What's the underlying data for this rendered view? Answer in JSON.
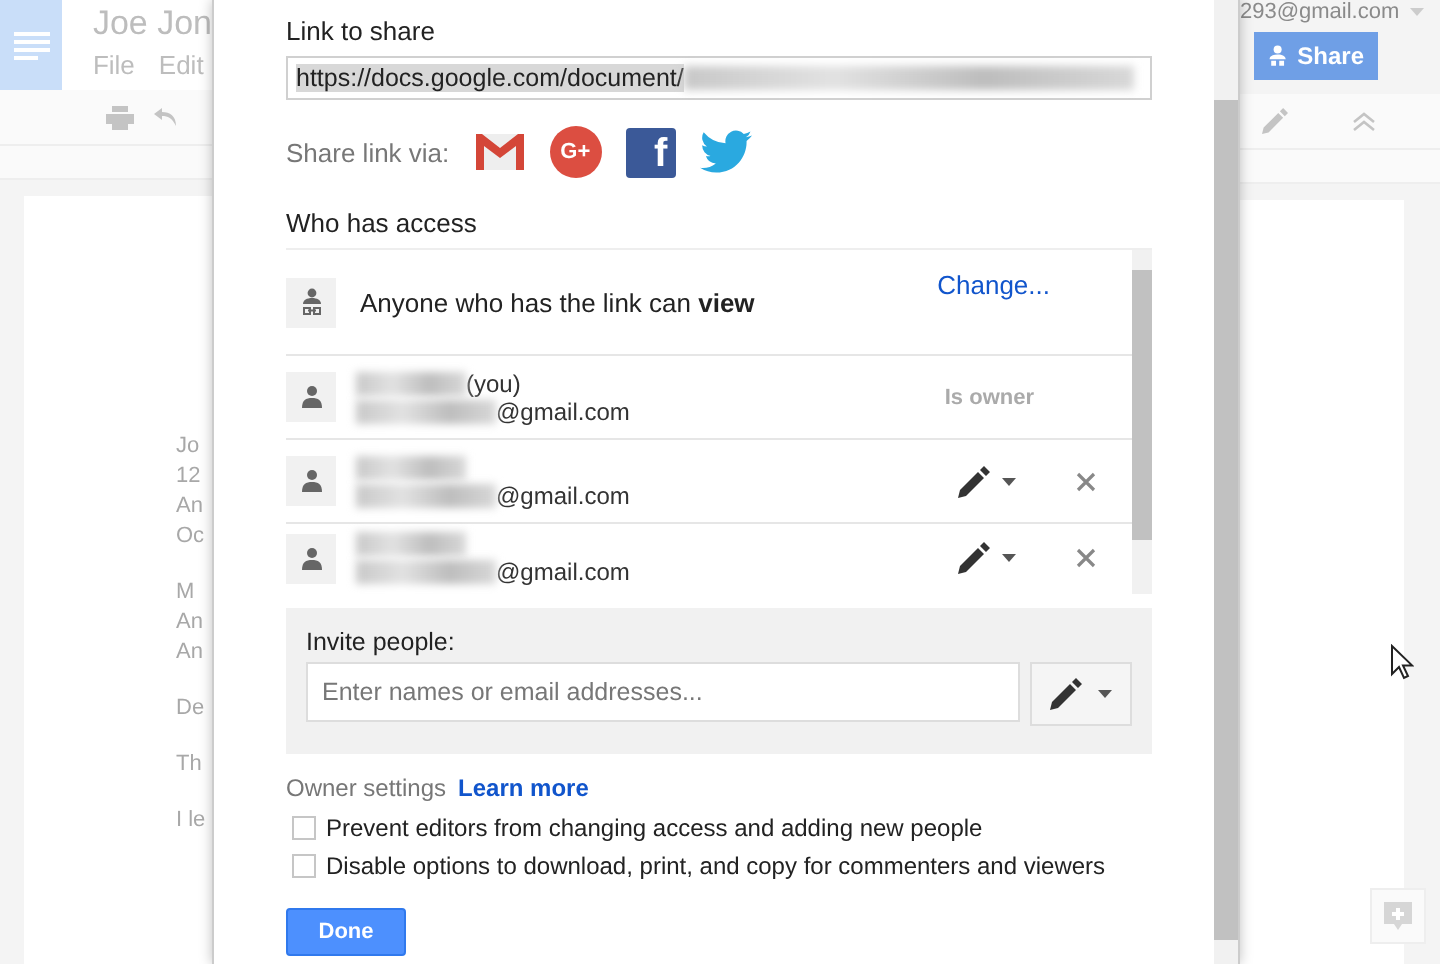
{
  "background_app": {
    "doc_title": "Joe Jon",
    "menu": [
      "File",
      "Edit"
    ],
    "account": "293@gmail.com",
    "share_button": "Share",
    "doc_paragraphs": [
      [
        "Jo",
        "12",
        "An",
        "Oc"
      ],
      [
        "M",
        "An",
        "An"
      ],
      [
        "De"
      ],
      [
        "Th"
      ],
      [
        "I le"
      ]
    ]
  },
  "dialog": {
    "link_label": "Link to share",
    "link_url": "https://docs.google.com/document/",
    "share_via_label": "Share link via:",
    "share_targets": [
      {
        "kind": "gmail"
      },
      {
        "kind": "gplus",
        "glyph": "G+"
      },
      {
        "kind": "facebook",
        "glyph": "f"
      },
      {
        "kind": "twitter"
      }
    ],
    "access_label": "Who has access",
    "link_access": {
      "text": "Anyone who has the link can **view**",
      "change": "Change..."
    },
    "people": [
      {
        "kind": "owner",
        "name": "(you)",
        "email": "@gmail.com",
        "role": "Is owner"
      },
      {
        "kind": "editor",
        "email": "@gmail.com"
      },
      {
        "kind": "editor",
        "email": "@gmail.com"
      }
    ],
    "invite": {
      "label": "Invite people:",
      "placeholder": "Enter names or email addresses..."
    },
    "owner_settings": {
      "label": "Owner settings",
      "link": "Learn more",
      "options": [
        {
          "label": "Prevent editors from changing access and adding new people",
          "checked": false
        },
        {
          "label": "Disable options to download, print, and copy for commenters and viewers",
          "checked": false
        }
      ]
    },
    "done": "Done"
  }
}
